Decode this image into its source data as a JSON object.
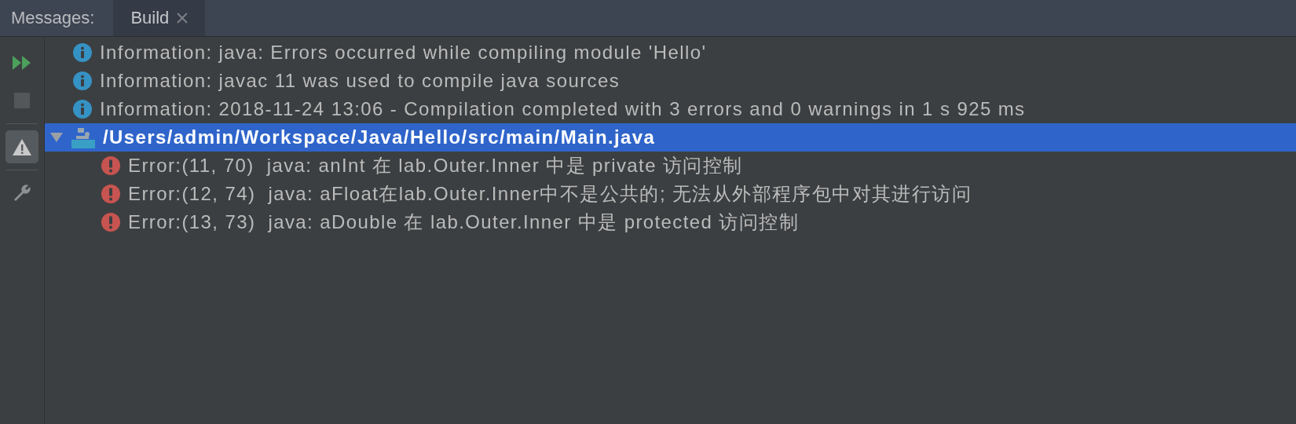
{
  "tab_bar": {
    "label": "Messages:",
    "tabs": [
      {
        "label": "Build",
        "selected": true,
        "closable": true
      }
    ]
  },
  "toolbar": [
    {
      "kind": "rerun",
      "selected": false,
      "disabled": false
    },
    {
      "kind": "stop",
      "selected": false,
      "disabled": true
    },
    {
      "kind": "divider"
    },
    {
      "kind": "warnings",
      "selected": true,
      "disabled": false
    },
    {
      "kind": "divider"
    },
    {
      "kind": "settings",
      "selected": false,
      "disabled": false
    }
  ],
  "messages": [
    {
      "kind": "info",
      "text": "Information: java: Errors occurred while compiling module 'Hello'",
      "selected": false
    },
    {
      "kind": "info",
      "text": "Information: javac 11 was used to compile java sources",
      "selected": false
    },
    {
      "kind": "info",
      "text": "Information: 2018-11-24 13:06 - Compilation completed with 3 errors and 0 warnings in 1 s 925 ms",
      "selected": false
    },
    {
      "kind": "file",
      "text": "/Users/admin/Workspace/Java/Hello/src/main/Main.java",
      "selected": true,
      "expanded": true,
      "children": [
        {
          "kind": "error",
          "text": "Error:(11, 70)  java: anInt 在 lab.Outer.Inner 中是 private 访问控制",
          "selected": false
        },
        {
          "kind": "error",
          "text": "Error:(12, 74)  java: aFloat在lab.Outer.Inner中不是公共的; 无法从外部程序包中对其进行访问",
          "selected": false
        },
        {
          "kind": "error",
          "text": "Error:(13, 73)  java: aDouble 在 lab.Outer.Inner 中是 protected 访问控制",
          "selected": false
        }
      ]
    }
  ]
}
